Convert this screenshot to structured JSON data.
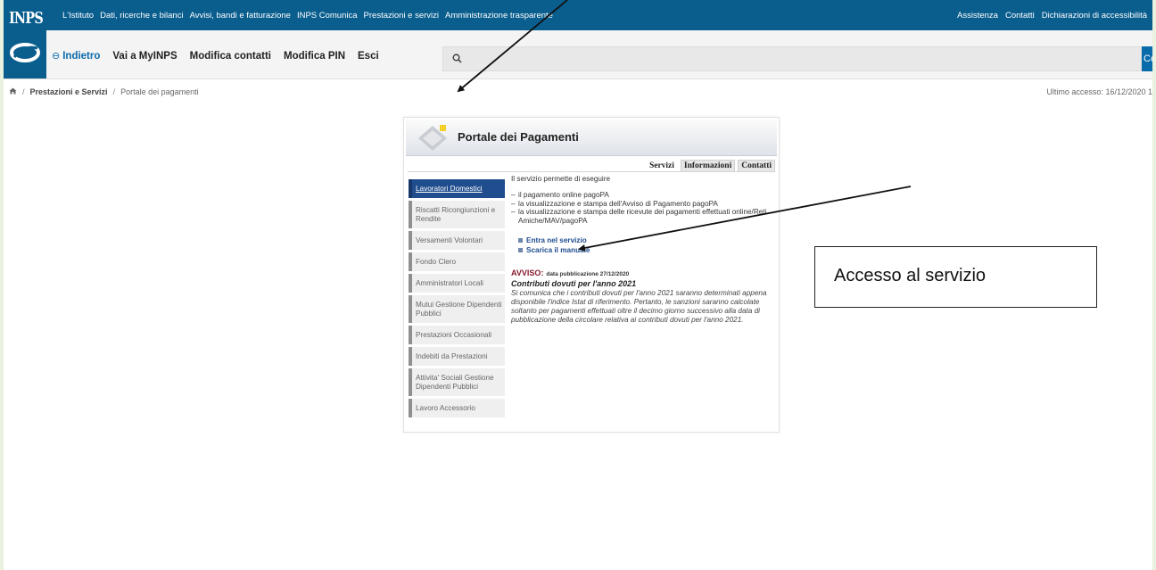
{
  "brand": "INPS",
  "top_links": [
    "L'Istituto",
    "Dati, ricerche e bilanci",
    "Avvisi, bandi e fatturazione",
    "INPS Comunica",
    "Prestazioni e servizi",
    "Amministrazione trasparente"
  ],
  "right_links": [
    "Assistenza",
    "Contatti",
    "Dichiarazioni di accessibilità"
  ],
  "nav": {
    "back_icon": "circle-minus-icon",
    "back_label": "Indietro",
    "links": [
      "Vai a MyINPS",
      "Modifica contatti",
      "Modifica PIN",
      "Esci"
    ]
  },
  "search": {
    "placeholder": "",
    "icon": "search-icon",
    "button_label": "Cerca"
  },
  "breadcrumb": {
    "home_icon": "home-icon",
    "section": "Prestazioni e Servizi",
    "current": "Portale dei pagamenti"
  },
  "last_access": "Ultimo accesso: 16/12/2020 1",
  "portal": {
    "title": "Portale dei Pagamenti",
    "tabs": [
      "Servizi",
      "Informazioni",
      "Contatti"
    ],
    "menu": [
      "Lavoratori Domestici",
      "Riscatti Ricongiunzioni e Rendite",
      "Versamenti Volontari",
      "Fondo Clero",
      "Amministratori Locali",
      "Mutui Gestione Dipendenti Pubblici",
      "Prestazioni Occasionali",
      "Indebiti da Prestazioni",
      "Attivita' Sociali Gestione Dipendenti Pubblici",
      "Lavoro Accessorio"
    ],
    "intro": "Il servizio permette di eseguire",
    "bullets": [
      "il pagamento online pagoPA",
      "la visualizzazione e stampa dell'Avviso di Pagamento pagoPA",
      "la visualizzazione e stampa delle ricevute dei pagamenti effettuati online/Reti Amiche/MAV/pagoPA"
    ],
    "links": [
      "Entra nel servizio",
      "Scarica il manuale"
    ],
    "notice": {
      "label": "AVVISO:",
      "date": "data pubblicazione 27/12/2020",
      "subtitle": "Contributi dovuti per l'anno 2021",
      "body": "Si comunica che i contributi dovuti per l'anno 2021 saranno determinati appena disponibile l'indice Istat di riferimento. Pertanto, le sanzioni saranno calcolate soltanto per pagamenti effettuati oltre il decimo giorno successivo alla data di pubblicazione della circolare relativa ai contributi dovuti per l'anno 2021."
    }
  },
  "annotation": "Accesso al servizio",
  "colors": {
    "header": "#0a5e8e",
    "accent": "#0a6bab",
    "menu_active": "#1f4d8e",
    "notice": "#8a1b2f",
    "frame": "#e9f1df"
  }
}
